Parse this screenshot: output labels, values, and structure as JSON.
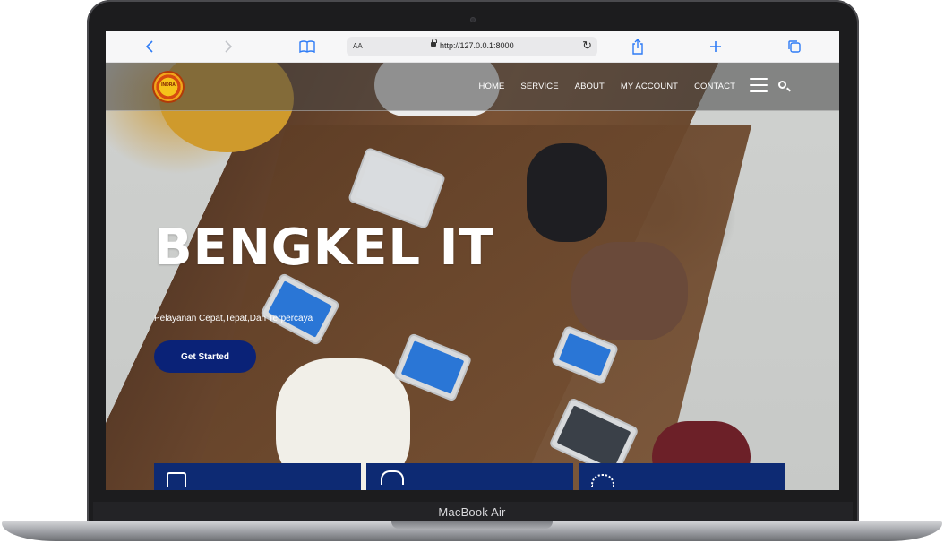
{
  "device": {
    "brand_label": "MacBook Air"
  },
  "browser": {
    "url_prefix": "AA",
    "url": "http://127.0.0.1:8000",
    "icons": {
      "back": "chevron-left-icon",
      "forward": "chevron-right-icon",
      "bookmarks": "book-icon",
      "reload": "reload-icon",
      "share": "share-icon",
      "new_tab": "plus-icon",
      "tabs": "tabs-icon"
    }
  },
  "site": {
    "logo_text": "INDRA",
    "nav": {
      "items": [
        {
          "label": "HOME"
        },
        {
          "label": "SERVICE"
        },
        {
          "label": "ABOUT"
        },
        {
          "label": "MY ACCOUNT"
        },
        {
          "label": "CONTACT"
        }
      ]
    },
    "hero": {
      "title": "BENGKEL IT",
      "subtitle": "Pelayanan Cepat,Tepat,Dan Terpercaya",
      "cta_label": "Get Started"
    },
    "colors": {
      "accent": "#0a2277",
      "card_bg": "#0d2a73"
    }
  }
}
